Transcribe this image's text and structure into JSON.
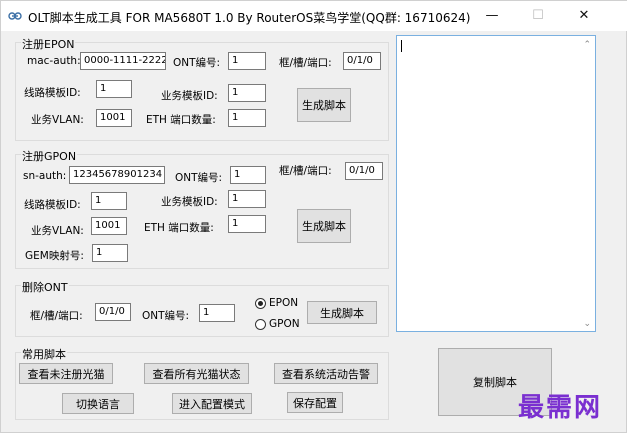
{
  "window": {
    "title": "OLT脚本生成工具 FOR MA5680T 1.0 By RouterOS菜鸟学堂(QQ群: 16710624)",
    "controls": {
      "minimize": "—",
      "maximize": "☐",
      "close": "✕"
    }
  },
  "epon": {
    "group_label": "注册EPON",
    "mac_label": "mac-auth:",
    "mac_value": "0000-1111-2222",
    "ont_label": "ONT编号:",
    "ont_value": "1",
    "fsp_label": "框/槽/端口:",
    "fsp_value": "0/1/0",
    "line_label": "线路模板ID:",
    "line_value": "1",
    "srv_label": "业务模板ID:",
    "srv_value": "1",
    "vlan_label": "业务VLAN:",
    "vlan_value": "1001",
    "eth_label": "ETH 端口数量:",
    "eth_value": "1",
    "gen_button": "生成脚本"
  },
  "gpon": {
    "group_label": "注册GPON",
    "sn_label": "sn-auth:",
    "sn_value": "12345678901234",
    "ont_label": "ONT编号:",
    "ont_value": "1",
    "fsp_label": "框/槽/端口:",
    "fsp_value": "0/1/0",
    "line_label": "线路模板ID:",
    "line_value": "1",
    "srv_label": "业务模板ID:",
    "srv_value": "1",
    "vlan_label": "业务VLAN:",
    "vlan_value": "1001",
    "eth_label": "ETH 端口数量:",
    "eth_value": "1",
    "gem_label": "GEM映射号:",
    "gem_value": "1",
    "gen_button": "生成脚本"
  },
  "delete": {
    "group_label": "删除ONT",
    "fsp_label": "框/槽/端口:",
    "fsp_value": "0/1/0",
    "ont_label": "ONT编号:",
    "ont_value": "1",
    "radio_epon": "EPON",
    "radio_gpon": "GPON",
    "selected": "EPON",
    "gen_button": "生成脚本"
  },
  "common": {
    "group_label": "常用脚本",
    "btn_unreg": "查看未注册光猫",
    "btn_all": "查看所有光猫状态",
    "btn_alarm": "查看系统活动告警",
    "btn_lang": "切换语言",
    "btn_config": "进入配置模式",
    "btn_save": "保存配置"
  },
  "output": {
    "copy_button": "复制脚本",
    "text": ""
  },
  "watermark": "最需网"
}
